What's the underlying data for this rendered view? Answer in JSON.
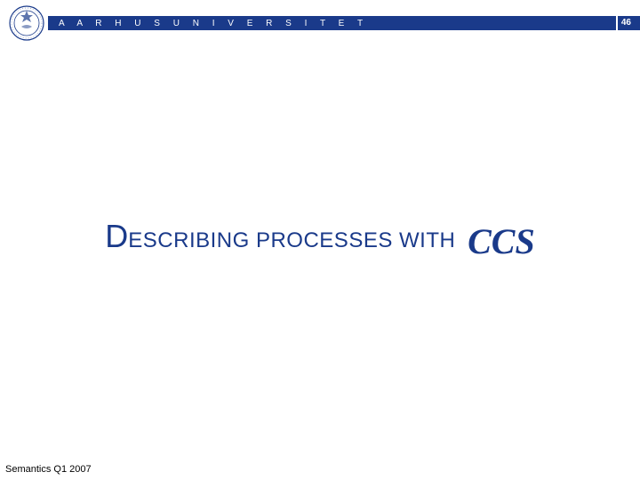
{
  "header": {
    "university_name": "A A R H U S   U N I V E R S I T E T",
    "page_number": "46"
  },
  "title": {
    "leading_cap": "D",
    "rest": "ESCRIBING PROCESSES WITH",
    "ccs": "CCS"
  },
  "footer": {
    "text": "Semantics Q1 2007"
  },
  "colors": {
    "brand": "#1a3a8a"
  }
}
